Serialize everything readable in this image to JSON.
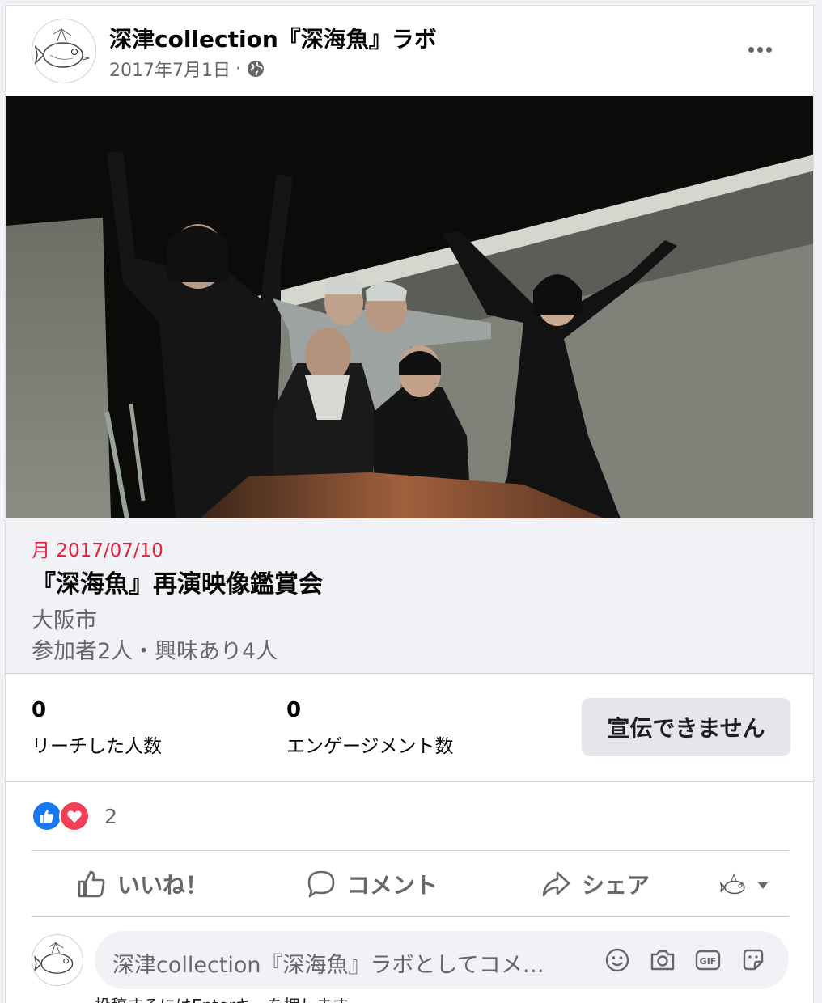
{
  "post": {
    "page_name": "深津collection『深海魚』ラボ",
    "date": "2017年7月1日",
    "separator": "·",
    "privacy_icon": "globe-icon",
    "more_icon": "more-options-icon"
  },
  "event": {
    "date": "月 2017/07/10",
    "title": "『深海魚』再演映像鑑賞会",
    "location": "大阪市",
    "attendance": "参加者2人・興味あり4人"
  },
  "insights": {
    "reach_value": "0",
    "reach_label": "リーチした人数",
    "engagement_value": "0",
    "engagement_label": "エンゲージメント数",
    "promote_label": "宣伝できません"
  },
  "reactions": {
    "icons": [
      "like-reaction-icon",
      "love-reaction-icon"
    ],
    "count": "2"
  },
  "actions": {
    "like_label": "いいね！",
    "comment_label": "コメント",
    "share_label": "シェア"
  },
  "composer": {
    "placeholder": "深津collection『深海魚』ラボとしてコメ…",
    "icons": [
      "emoji-icon",
      "camera-icon",
      "gif-icon",
      "sticker-icon"
    ],
    "hint": "投稿するにはEnterキーを押します。"
  },
  "colors": {
    "accent_blue": "#1877f2",
    "love_red": "#f33e58",
    "event_date_red": "#e41e3f",
    "secondary_text": "#65676b"
  }
}
